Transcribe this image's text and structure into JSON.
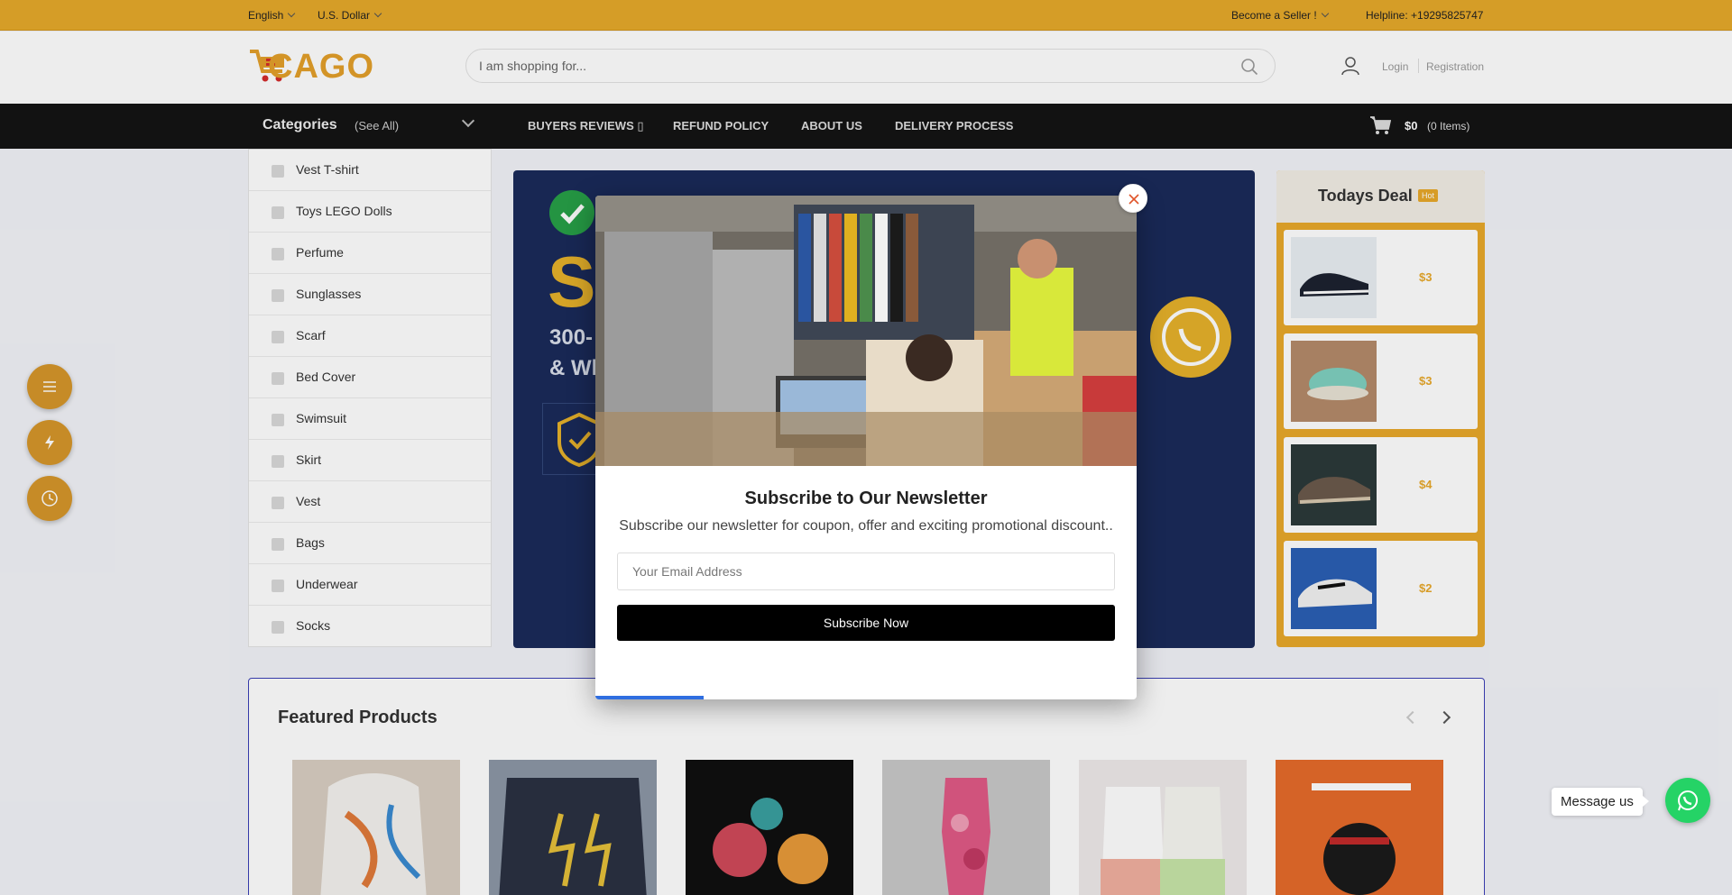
{
  "topbar": {
    "language": "English",
    "currency": "U.S. Dollar",
    "seller": "Become a Seller !",
    "helpline": "Helpline: +19295825747"
  },
  "header": {
    "logo_text": "CAGO",
    "search_placeholder": "I am shopping for...",
    "login": "Login",
    "registration": "Registration"
  },
  "nav": {
    "categories_title": "Categories",
    "see_all": "(See All)",
    "links": [
      "BUYERS REVIEWS ▯",
      "REFUND POLICY",
      "ABOUT US",
      "DELIVERY PROCESS"
    ],
    "cart_amount": "$0",
    "cart_items": "(0 Items)"
  },
  "sidebar": {
    "items": [
      "Vest T-shirt",
      "Toys LEGO Dolls",
      "Perfume",
      "Sunglasses",
      "Scarf",
      "Bed Cover",
      "Swimsuit",
      "Skirt",
      "Vest",
      "Bags",
      "Underwear",
      "Socks"
    ]
  },
  "hero": {
    "big": "S",
    "line1": "300-",
    "line2": "& Wh"
  },
  "deal": {
    "title": "Todays Deal",
    "badge": "Hot",
    "prices": [
      "$3",
      "$3",
      "$4",
      "$2"
    ]
  },
  "featured": {
    "title": "Featured Products"
  },
  "modal": {
    "title": "Subscribe to Our Newsletter",
    "description": "Subscribe our newsletter for coupon, offer and exciting promotional discount..",
    "email_placeholder": "Your Email Address",
    "button": "Subscribe Now",
    "progress": 0.2
  },
  "chat": {
    "label": "Message us"
  },
  "colors": {
    "accent": "#e6a92a",
    "nav_bg": "#141414",
    "progress": "#2f6ee0",
    "whatsapp": "#25d366"
  }
}
